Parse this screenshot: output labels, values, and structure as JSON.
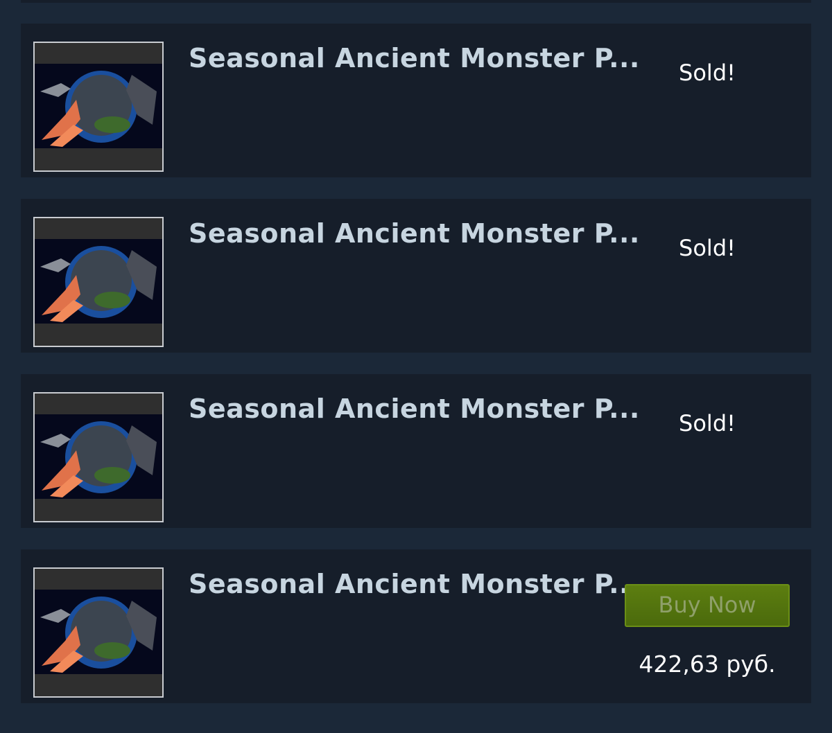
{
  "listings": [
    {
      "name": "Seasonal Ancient Monster P...",
      "status": "Sold!"
    },
    {
      "name": "Seasonal Ancient Monster P...",
      "status": "Sold!"
    },
    {
      "name": "Seasonal Ancient Monster P...",
      "status": "Sold!"
    },
    {
      "name": "Seasonal Ancient Monster P...",
      "buy_label": "Buy Now",
      "price": "422,63 руб."
    }
  ],
  "colors": {
    "page_background": "#1b2838",
    "listing_background": "#161e2a",
    "title_text": "#c7d5e0",
    "buy_button": "#5c7e10"
  }
}
